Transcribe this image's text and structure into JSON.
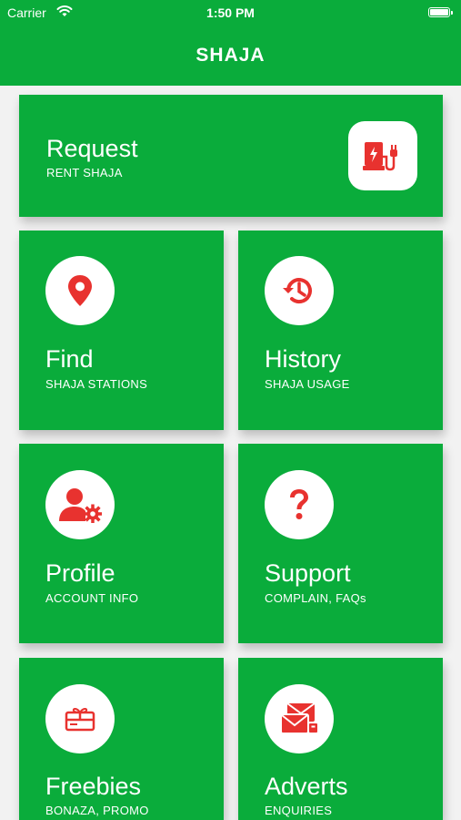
{
  "status": {
    "carrier": "Carrier",
    "time": "1:50 PM"
  },
  "header": {
    "title": "SHAJA"
  },
  "colors": {
    "primary": "#0aac3b",
    "accent": "#e8322f"
  },
  "tiles": [
    {
      "title": "Request",
      "subtitle": "RENT SHAJA",
      "icon": "ev-charger-icon"
    },
    {
      "title": "Find",
      "subtitle": "SHAJA STATIONS",
      "icon": "map-pin-icon"
    },
    {
      "title": "History",
      "subtitle": "SHAJA USAGE",
      "icon": "history-icon"
    },
    {
      "title": "Profile",
      "subtitle": "ACCOUNT INFO",
      "icon": "user-settings-icon"
    },
    {
      "title": "Support",
      "subtitle": "COMPLAIN, FAQs",
      "icon": "question-icon"
    },
    {
      "title": "Freebies",
      "subtitle": "BONAZA, PROMO",
      "icon": "gift-card-icon"
    },
    {
      "title": "Adverts",
      "subtitle": "ENQUIRIES",
      "icon": "mail-icon"
    }
  ]
}
